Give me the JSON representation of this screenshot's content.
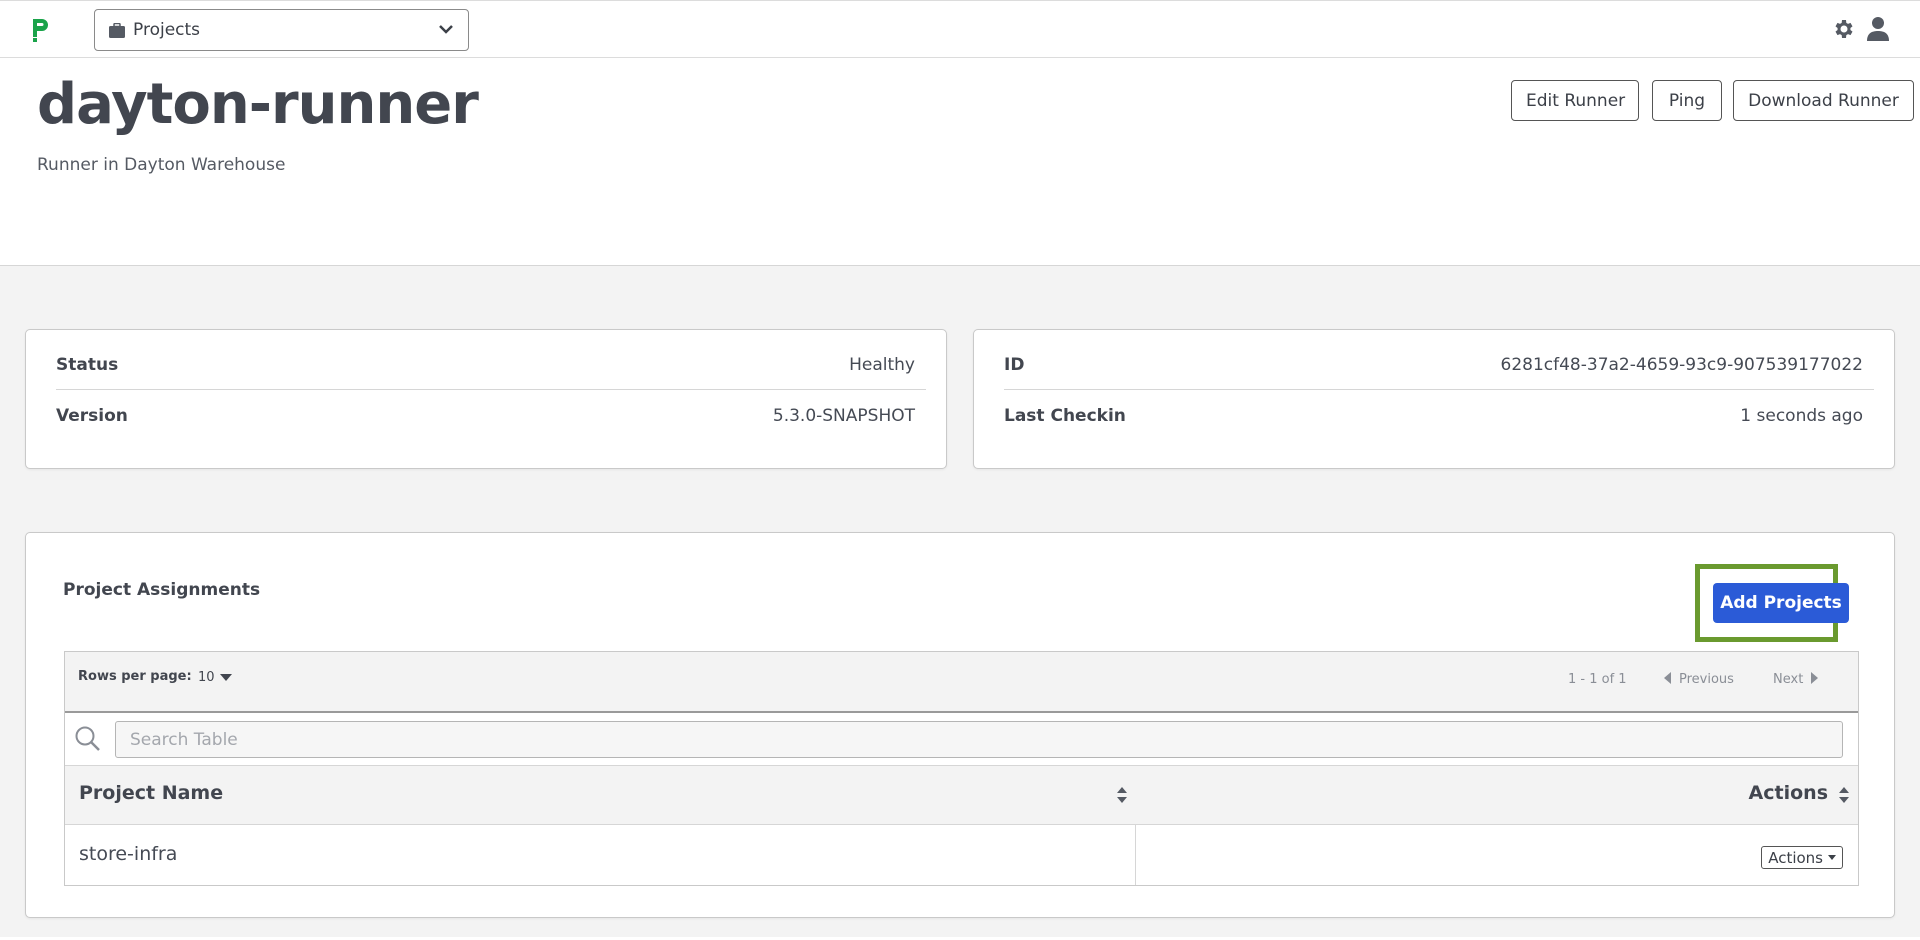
{
  "topbar": {
    "project_switcher_label": "Projects"
  },
  "runner": {
    "name": "dayton-runner",
    "description": "Runner in Dayton Warehouse"
  },
  "header_actions": {
    "edit_label": "Edit Runner",
    "ping_label": "Ping",
    "download_label": "Download Runner"
  },
  "info_left": {
    "status_key": "Status",
    "status_value": "Healthy",
    "version_key": "Version",
    "version_value": "5.3.0-SNAPSHOT"
  },
  "info_right": {
    "id_key": "ID",
    "id_value": "6281cf48-37a2-4659-93c9-907539177022",
    "checkin_key": "Last Checkin",
    "checkin_value": "1 seconds ago"
  },
  "assignments": {
    "title": "Project Assignments",
    "add_label": "Add Projects",
    "table": {
      "rows_per_page_label": "Rows per page:",
      "rows_per_page_value": "10",
      "range": "1 - 1 of 1",
      "previous_label": "Previous",
      "next_label": "Next",
      "search_placeholder": "Search Table",
      "columns": [
        "Project Name",
        "Actions"
      ],
      "rows": [
        {
          "name": "store-infra",
          "actions_label": "Actions"
        }
      ]
    }
  },
  "colors": {
    "brand_green": "#1aa34a",
    "primary_blue": "#2b5bd7",
    "highlight_green": "#6a9a2f"
  }
}
